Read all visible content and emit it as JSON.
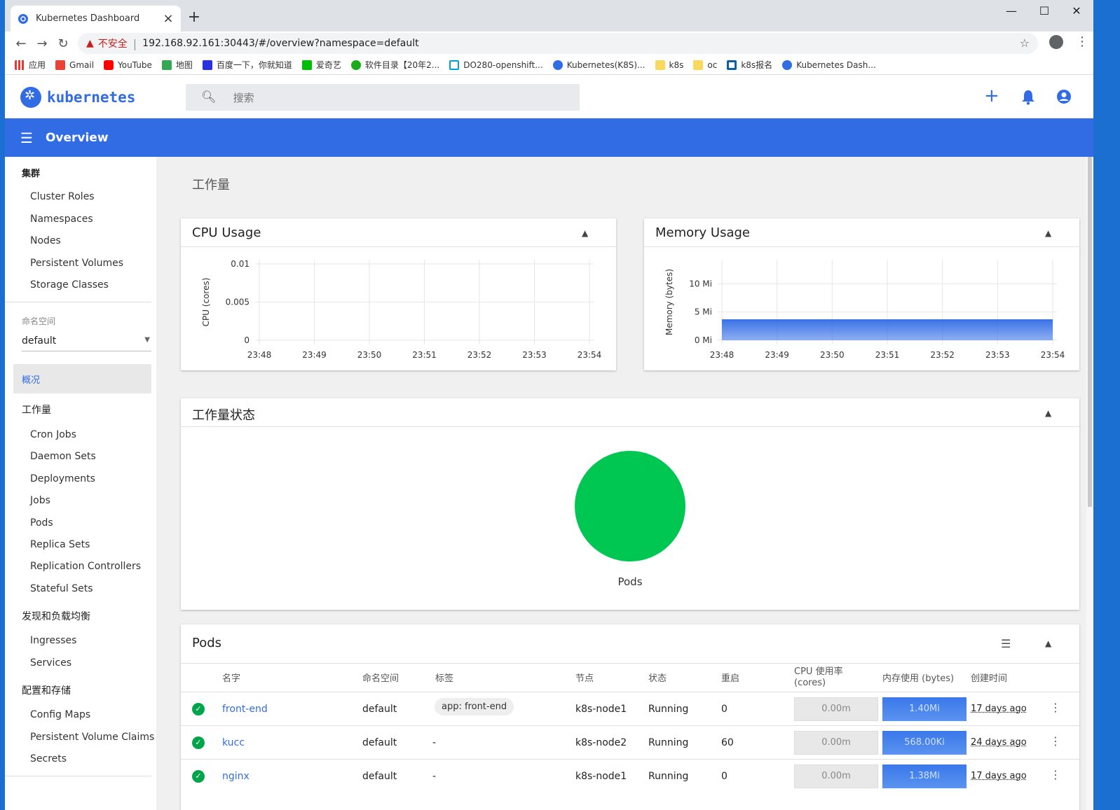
{
  "browser": {
    "tab_title": "Kubernetes Dashboard",
    "url": "192.168.92.161:30443/#/overview?namespace=default",
    "insecure_label": "不安全",
    "bookmarks": [
      "应用",
      "Gmail",
      "YouTube",
      "地图",
      "百度一下，你就知道",
      "爱奇艺",
      "软件目录【20年2...",
      "DO280-openshift...",
      "Kubernetes(K8S)...",
      "k8s",
      "oc",
      "k8s报名",
      "Kubernetes Dash..."
    ]
  },
  "header": {
    "logo_text": "kubernetes",
    "search_placeholder": "搜索",
    "page_title": "Overview"
  },
  "sidebar": {
    "cluster_heading": "集群",
    "cluster_items": [
      "Cluster Roles",
      "Namespaces",
      "Nodes",
      "Persistent Volumes",
      "Storage Classes"
    ],
    "namespace_label": "命名空间",
    "namespace_value": "default",
    "overview": "概况",
    "workloads_heading": "工作量",
    "workload_items": [
      "Cron Jobs",
      "Daemon Sets",
      "Deployments",
      "Jobs",
      "Pods",
      "Replica Sets",
      "Replication Controllers",
      "Stateful Sets"
    ],
    "discovery_heading": "发现和负载均衡",
    "discovery_items": [
      "Ingresses",
      "Services"
    ],
    "config_heading": "配置和存储",
    "config_items": [
      "Config Maps",
      "Persistent Volume Claims",
      "Secrets"
    ]
  },
  "main": {
    "section_title": "工作量",
    "cpu_card_title": "CPU Usage",
    "mem_card_title": "Memory Usage",
    "status_card_title": "工作量状态",
    "pods_card_title": "Pods",
    "pods_label": "Pods"
  },
  "chart_data": [
    {
      "type": "line",
      "title": "CPU Usage",
      "ylabel": "CPU (cores)",
      "x": [
        "23:48",
        "23:49",
        "23:50",
        "23:51",
        "23:52",
        "23:53",
        "23:54"
      ],
      "y_ticks": [
        "0",
        "0.005",
        "0.01"
      ],
      "ylim": [
        0,
        0.01
      ],
      "series": [
        {
          "values": [
            0,
            0,
            0,
            0,
            0,
            0,
            0
          ]
        }
      ]
    },
    {
      "type": "area",
      "title": "Memory Usage",
      "ylabel": "Memory (bytes)",
      "x": [
        "23:48",
        "23:49",
        "23:50",
        "23:51",
        "23:52",
        "23:53",
        "23:54"
      ],
      "y_ticks": [
        "0 Mi",
        "5 Mi",
        "10 Mi"
      ],
      "ylim": [
        0,
        13.5
      ],
      "series": [
        {
          "values": [
            3.6,
            3.6,
            3.6,
            3.6,
            3.6,
            3.6,
            3.6
          ]
        }
      ],
      "color": "#326ce5"
    },
    {
      "type": "pie",
      "title": "工作量状态",
      "slices": [
        {
          "label": "Pods",
          "value": 100,
          "color": "#00c752"
        }
      ]
    }
  ],
  "pods_table": {
    "headers": [
      "名字",
      "命名空间",
      "标签",
      "节点",
      "状态",
      "重启",
      "CPU 使用率 (cores)",
      "内存使用 (bytes)",
      "创建时间"
    ],
    "rows": [
      {
        "name": "front-end",
        "namespace": "default",
        "labels": "app: front-end",
        "node": "k8s-node1",
        "status": "Running",
        "restarts": "0",
        "cpu": "0.00m",
        "memory": "1.40Mi",
        "age": "17 days ago"
      },
      {
        "name": "kucc",
        "namespace": "default",
        "labels": "-",
        "node": "k8s-node2",
        "status": "Running",
        "restarts": "60",
        "cpu": "0.00m",
        "memory": "568.00Ki",
        "age": "24 days ago"
      },
      {
        "name": "nginx",
        "namespace": "default",
        "labels": "-",
        "node": "k8s-node1",
        "status": "Running",
        "restarts": "0",
        "cpu": "0.00m",
        "memory": "1.38Mi",
        "age": "17 days ago"
      }
    ]
  }
}
